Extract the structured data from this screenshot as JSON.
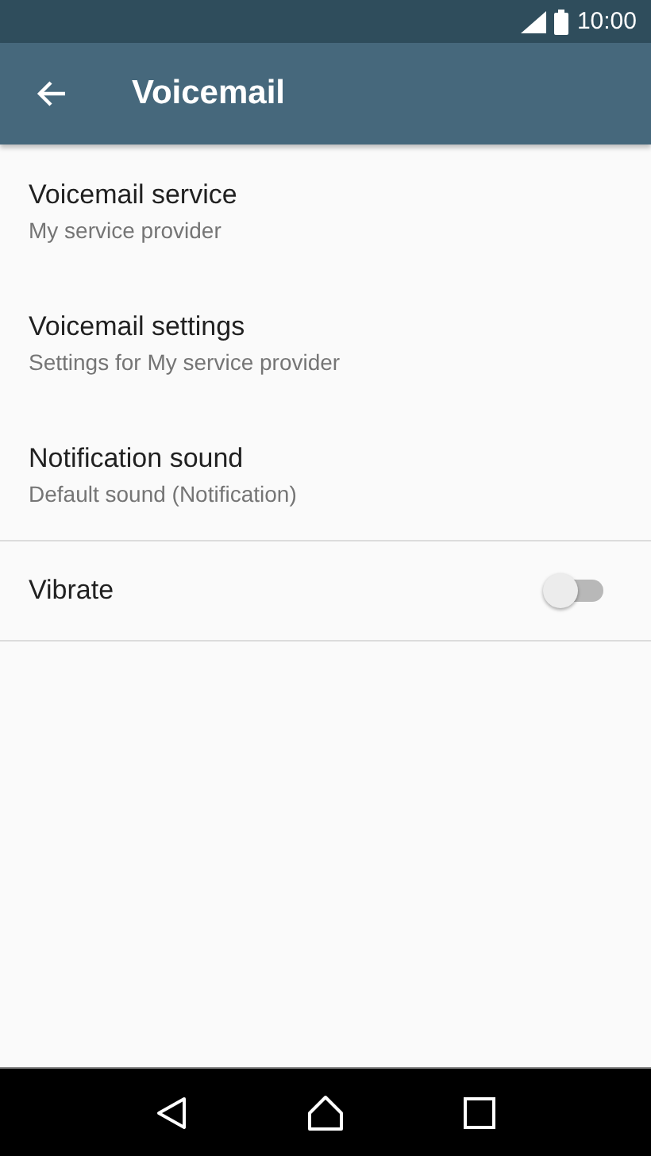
{
  "status_bar": {
    "time": "10:00"
  },
  "app_bar": {
    "title": "Voicemail"
  },
  "sections": [
    {
      "items": [
        {
          "kind": "text",
          "title": "Voicemail service",
          "summary": "My service provider"
        },
        {
          "kind": "text",
          "title": "Voicemail settings",
          "summary": "Settings for My service provider"
        },
        {
          "kind": "text",
          "title": "Notification sound",
          "summary": "Default sound (Notification)"
        }
      ]
    },
    {
      "items": [
        {
          "kind": "toggle",
          "title": "Vibrate",
          "on": false
        }
      ]
    }
  ]
}
